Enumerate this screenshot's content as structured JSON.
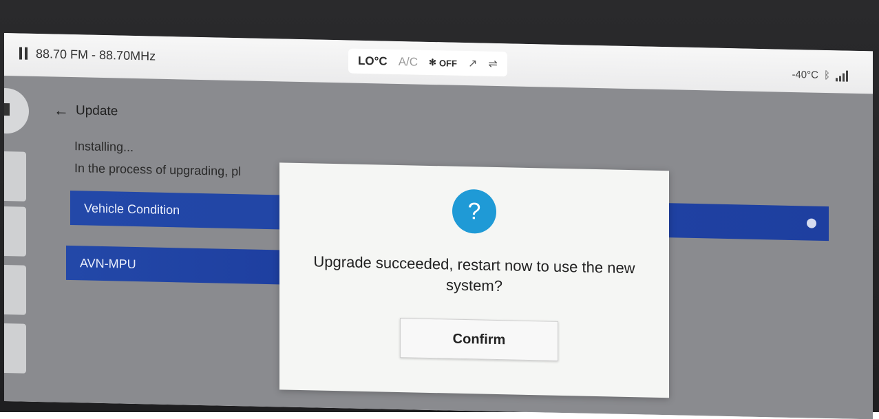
{
  "status_bar": {
    "radio": "88.70 FM - 88.70MHz",
    "climate": {
      "temperature": "LO°C",
      "ac": "A/C",
      "fan": "OFF"
    },
    "outside_temp": "-40°C"
  },
  "page": {
    "back_label": "Update",
    "status_title": "Installing...",
    "status_desc": "In the process of upgrading, pl",
    "items": [
      {
        "label": "Vehicle Condition"
      },
      {
        "label": "AVN-MPU"
      }
    ]
  },
  "dialog": {
    "icon_glyph": "?",
    "message": "Upgrade succeeded, restart now to use the new system?",
    "confirm_label": "Confirm"
  },
  "colors": {
    "item_bar": "#2348a8",
    "dialog_icon": "#1f9ad6"
  }
}
